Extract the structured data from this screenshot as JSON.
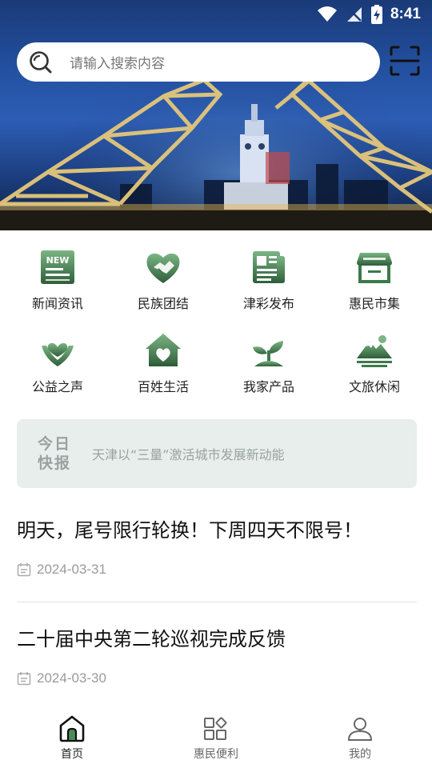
{
  "status_bar": {
    "time": "8:41"
  },
  "search": {
    "placeholder": "请输入搜索内容"
  },
  "grid": [
    {
      "label": "新闻资讯",
      "icon": "news-icon"
    },
    {
      "label": "民族团结",
      "icon": "handshake-heart-icon"
    },
    {
      "label": "津彩发布",
      "icon": "newspaper-icon"
    },
    {
      "label": "惠民市集",
      "icon": "store-icon"
    },
    {
      "label": "公益之声",
      "icon": "hands-heart-icon"
    },
    {
      "label": "百姓生活",
      "icon": "home-heart-icon"
    },
    {
      "label": "我家产品",
      "icon": "sprout-icon"
    },
    {
      "label": "文旅休闲",
      "icon": "mountain-icon"
    }
  ],
  "news_badge_text": "NEW",
  "bulletin": {
    "tag_line1": "今日",
    "tag_line2": "快报",
    "text": "天津以“三量”激活城市发展新动能"
  },
  "articles": [
    {
      "title": "明天，尾号限行轮换！下周四天不限号！",
      "date": "2024-03-31"
    },
    {
      "title": "二十届中央第二轮巡视完成反馈",
      "date": "2024-03-30"
    }
  ],
  "bottom_nav": [
    {
      "label": "首页",
      "icon": "home-icon",
      "active": true
    },
    {
      "label": "惠民便利",
      "icon": "apps-icon",
      "active": false
    },
    {
      "label": "我的",
      "icon": "user-icon",
      "active": false
    }
  ],
  "colors": {
    "accent_green": "#3d7a4a",
    "icon_gradient_top": "#6aa573",
    "icon_gradient_bottom": "#2f5e3a",
    "bulletin_bg": "#e7eeec"
  }
}
